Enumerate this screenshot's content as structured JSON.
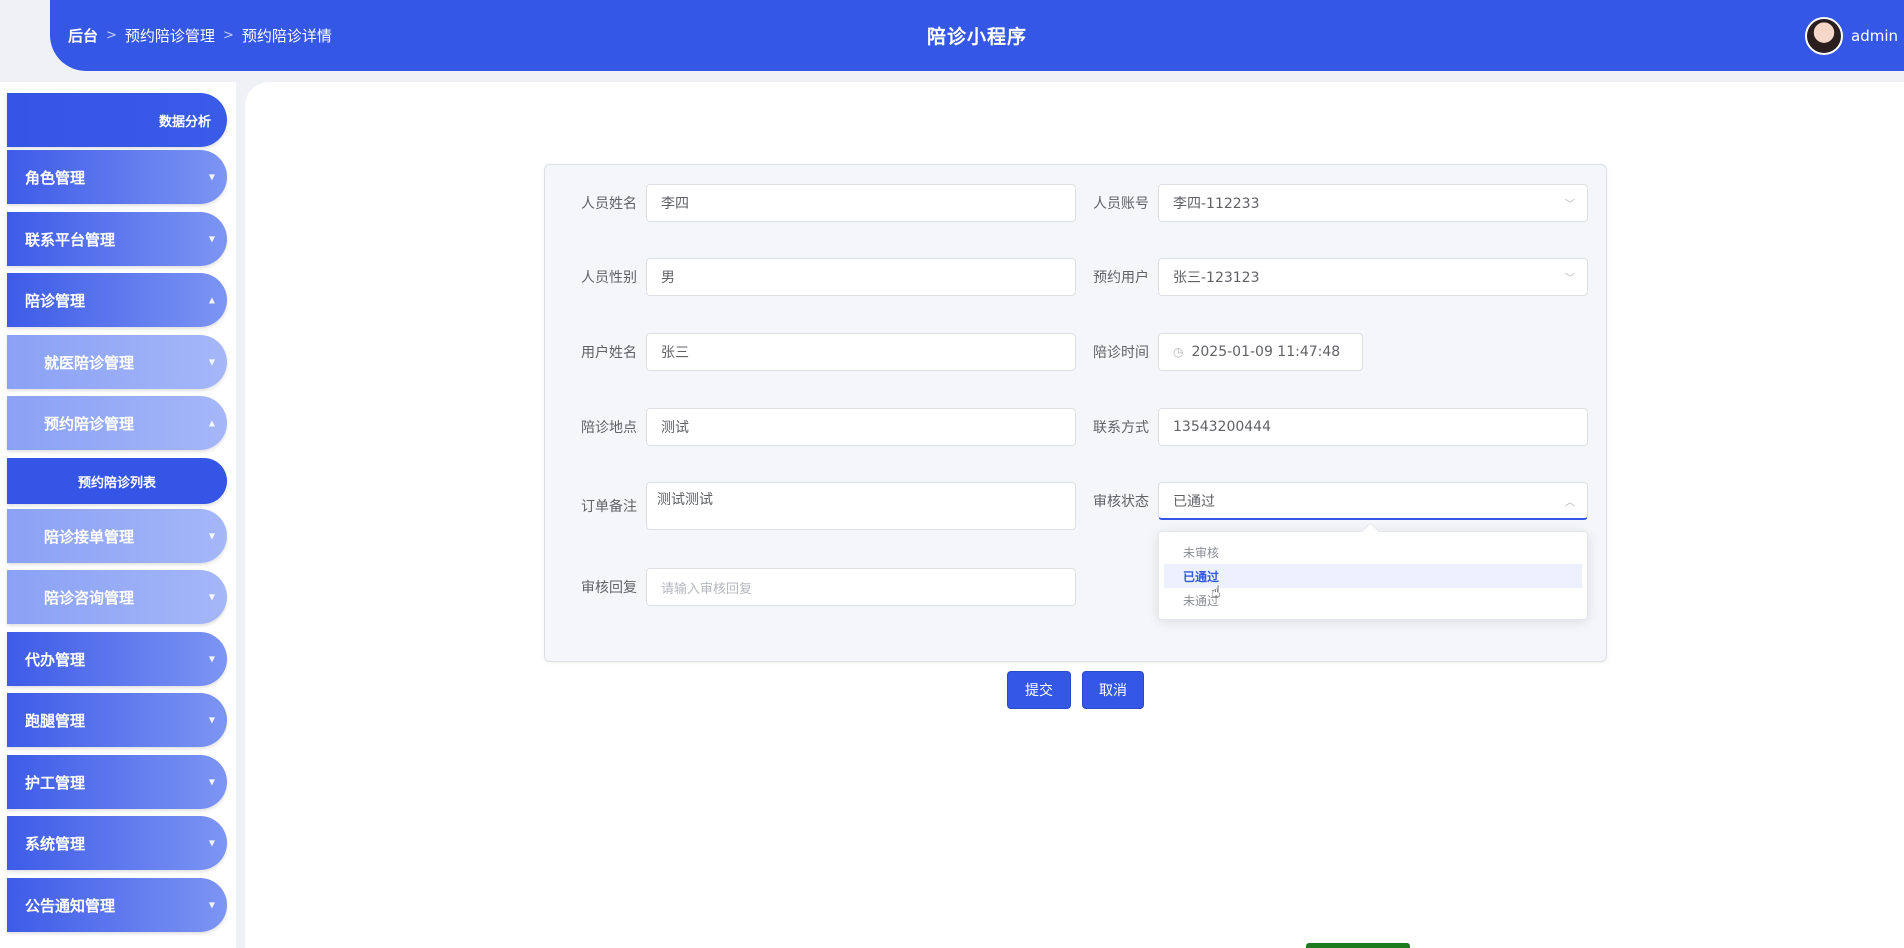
{
  "header": {
    "breadcrumb": [
      "后台",
      "预约陪诊管理",
      "预约陪诊详情"
    ],
    "separator": ">",
    "title": "陪诊小程序",
    "username": "admin"
  },
  "sidebar": {
    "top": "数据分析",
    "items": [
      {
        "label": "角色管理",
        "caret": "▼"
      },
      {
        "label": "联系平台管理",
        "caret": "▼"
      },
      {
        "label": "陪诊管理",
        "caret": "▲"
      },
      {
        "label": "就医陪诊管理",
        "caret": "▼"
      },
      {
        "label": "预约陪诊管理",
        "caret": "▲"
      },
      {
        "label": "预约陪诊列表"
      },
      {
        "label": "陪诊接单管理",
        "caret": "▼"
      },
      {
        "label": "陪诊咨询管理",
        "caret": "▼"
      },
      {
        "label": "代办管理",
        "caret": "▼"
      },
      {
        "label": "跑腿管理",
        "caret": "▼"
      },
      {
        "label": "护工管理",
        "caret": "▼"
      },
      {
        "label": "系统管理",
        "caret": "▼"
      },
      {
        "label": "公告通知管理",
        "caret": "▼"
      }
    ]
  },
  "form": {
    "name": {
      "label": "人员姓名",
      "value": "李四"
    },
    "account": {
      "label": "人员账号",
      "value": "李四-112233"
    },
    "gender": {
      "label": "人员性别",
      "value": "男"
    },
    "booking_user": {
      "label": "预约用户",
      "value": "张三-123123"
    },
    "user_name": {
      "label": "用户姓名",
      "value": "张三"
    },
    "time": {
      "label": "陪诊时间",
      "value": "2025-01-09 11:47:48"
    },
    "location": {
      "label": "陪诊地点",
      "value": "测试"
    },
    "contact": {
      "label": "联系方式",
      "value": "13543200444"
    },
    "remark": {
      "label": "订单备注",
      "value": "测试测试"
    },
    "status": {
      "label": "审核状态",
      "value": "已通过"
    },
    "reply": {
      "label": "审核回复",
      "placeholder": "请输入审核回复"
    }
  },
  "status_options": [
    "未审核",
    "已通过",
    "未通过"
  ],
  "buttons": {
    "submit": "提交",
    "cancel": "取消"
  },
  "colors": {
    "primary": "#3457e6",
    "sidebar_gradient_end": "#7d95f3"
  },
  "icons": {
    "arrow": "chevron-down-icon",
    "clock": "clock-icon"
  }
}
